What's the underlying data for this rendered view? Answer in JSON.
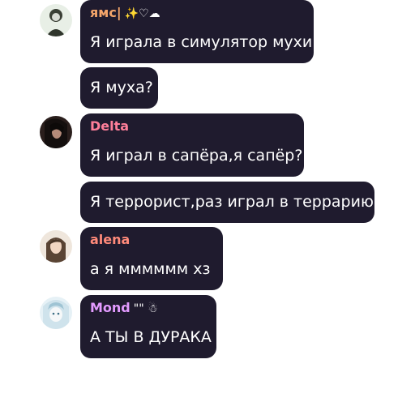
{
  "messages": [
    {
      "author": "ямс|",
      "author_color": "#f4a56a",
      "decoration": "✨♡☁",
      "text": "Я играла в симулятор мухи",
      "avatar_icon": "avatar-yams"
    },
    {
      "text": "Я муха?"
    },
    {
      "author": "Delta",
      "author_color": "#ff7f9a",
      "text": "Я играл в сапёра,я сапёр?",
      "avatar_icon": "avatar-delta"
    },
    {
      "text": "Я террорист,раз играл в террарию"
    },
    {
      "author": "alena",
      "author_color": "#ff8a7a",
      "text": "а я  мммммм хз",
      "avatar_icon": "avatar-alena"
    },
    {
      "author": "Mond",
      "author_color": "#e39bff",
      "decoration": "\"\" ☃",
      "text": "А ТЫ В ДУРАКА",
      "avatar_icon": "avatar-mond"
    }
  ],
  "colors": {
    "bubble": "#1f1b2e",
    "background": "#ffffff"
  }
}
